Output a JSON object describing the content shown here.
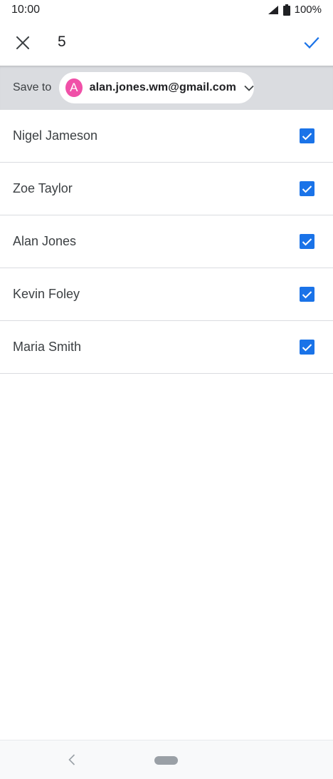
{
  "status_bar": {
    "time": "10:00",
    "battery": "100%",
    "signal_icon": "signal-icon",
    "battery_icon": "battery-icon"
  },
  "app_bar": {
    "close_icon": "close-icon",
    "selected_count": "5",
    "done_icon": "check-icon"
  },
  "save_to": {
    "label": "Save to",
    "account": {
      "avatar_letter": "A",
      "email": "alan.jones.wm@gmail.com",
      "dropdown_icon": "chevron-down-icon"
    }
  },
  "contacts": [
    {
      "name": "Nigel Jameson",
      "checked": true
    },
    {
      "name": "Zoe Taylor",
      "checked": true
    },
    {
      "name": "Alan Jones",
      "checked": true
    },
    {
      "name": "Kevin Foley",
      "checked": true
    },
    {
      "name": "Maria Smith",
      "checked": true
    }
  ],
  "nav_bar": {
    "back_icon": "back-chevron-icon",
    "home_icon": "home-pill-icon"
  },
  "colors": {
    "accent": "#1a73e8",
    "avatar": "#f050a8",
    "save_bar_bg": "#dadce0",
    "divider": "#dadce0",
    "text_primary": "#202124",
    "text_secondary": "#3c4043"
  }
}
